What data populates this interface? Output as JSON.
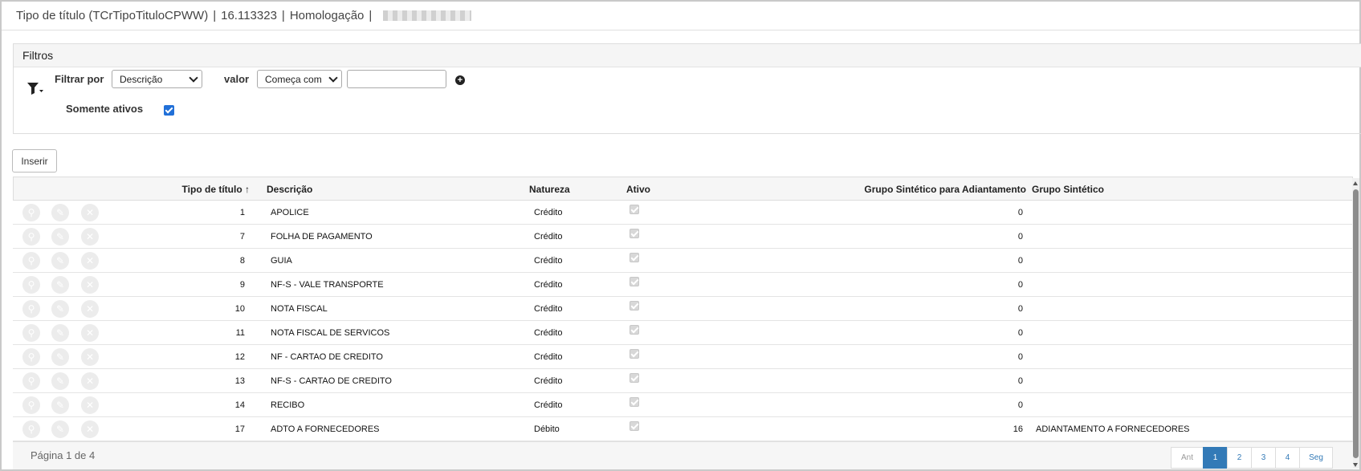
{
  "window": {
    "title": "Tipo de título (TCrTipoTituloCPWW)",
    "version": "16.113323",
    "environment": "Homologação",
    "separator": "|"
  },
  "filters": {
    "heading": "Filtros",
    "filter_by_label": "Filtrar por",
    "filter_by_value": "Descrição",
    "value_label": "valor",
    "operator_value": "Começa com",
    "value_input": "",
    "active_only_label": "Somente ativos",
    "active_only_checked": true
  },
  "toolbar": {
    "insert_label": "Inserir"
  },
  "table": {
    "columns": {
      "tipo": "Tipo de título",
      "descricao": "Descrição",
      "natureza": "Natureza",
      "ativo": "Ativo",
      "grupo_adiant": "Grupo Sintético para Adiantamento",
      "grupo": "Grupo Sintético"
    },
    "sort_indicator": "↑",
    "rows": [
      {
        "tipo": "1",
        "descricao": "APOLICE",
        "natureza": "Crédito",
        "ativo": true,
        "grupo_adiant": "0",
        "grupo": ""
      },
      {
        "tipo": "7",
        "descricao": "FOLHA DE PAGAMENTO",
        "natureza": "Crédito",
        "ativo": true,
        "grupo_adiant": "0",
        "grupo": ""
      },
      {
        "tipo": "8",
        "descricao": "GUIA",
        "natureza": "Crédito",
        "ativo": true,
        "grupo_adiant": "0",
        "grupo": ""
      },
      {
        "tipo": "9",
        "descricao": "NF-S - VALE TRANSPORTE",
        "natureza": "Crédito",
        "ativo": true,
        "grupo_adiant": "0",
        "grupo": ""
      },
      {
        "tipo": "10",
        "descricao": "NOTA FISCAL",
        "natureza": "Crédito",
        "ativo": true,
        "grupo_adiant": "0",
        "grupo": ""
      },
      {
        "tipo": "11",
        "descricao": "NOTA FISCAL DE SERVICOS",
        "natureza": "Crédito",
        "ativo": true,
        "grupo_adiant": "0",
        "grupo": ""
      },
      {
        "tipo": "12",
        "descricao": "NF - CARTAO DE CREDITO",
        "natureza": "Crédito",
        "ativo": true,
        "grupo_adiant": "0",
        "grupo": ""
      },
      {
        "tipo": "13",
        "descricao": "NF-S - CARTAO DE CREDITO",
        "natureza": "Crédito",
        "ativo": true,
        "grupo_adiant": "0",
        "grupo": ""
      },
      {
        "tipo": "14",
        "descricao": "RECIBO",
        "natureza": "Crédito",
        "ativo": true,
        "grupo_adiant": "0",
        "grupo": ""
      },
      {
        "tipo": "17",
        "descricao": "ADTO A FORNECEDORES",
        "natureza": "Débito",
        "ativo": true,
        "grupo_adiant": "16",
        "grupo": "ADIANTAMENTO A FORNECEDORES"
      }
    ]
  },
  "pagination": {
    "info": "Página 1 de 4",
    "prev_label": "Ant",
    "next_label": "Seg",
    "pages": [
      "1",
      "2",
      "3",
      "4"
    ],
    "current_page": "1"
  },
  "colors": {
    "accent": "#337ab7",
    "checkbox": "#2170d8"
  }
}
